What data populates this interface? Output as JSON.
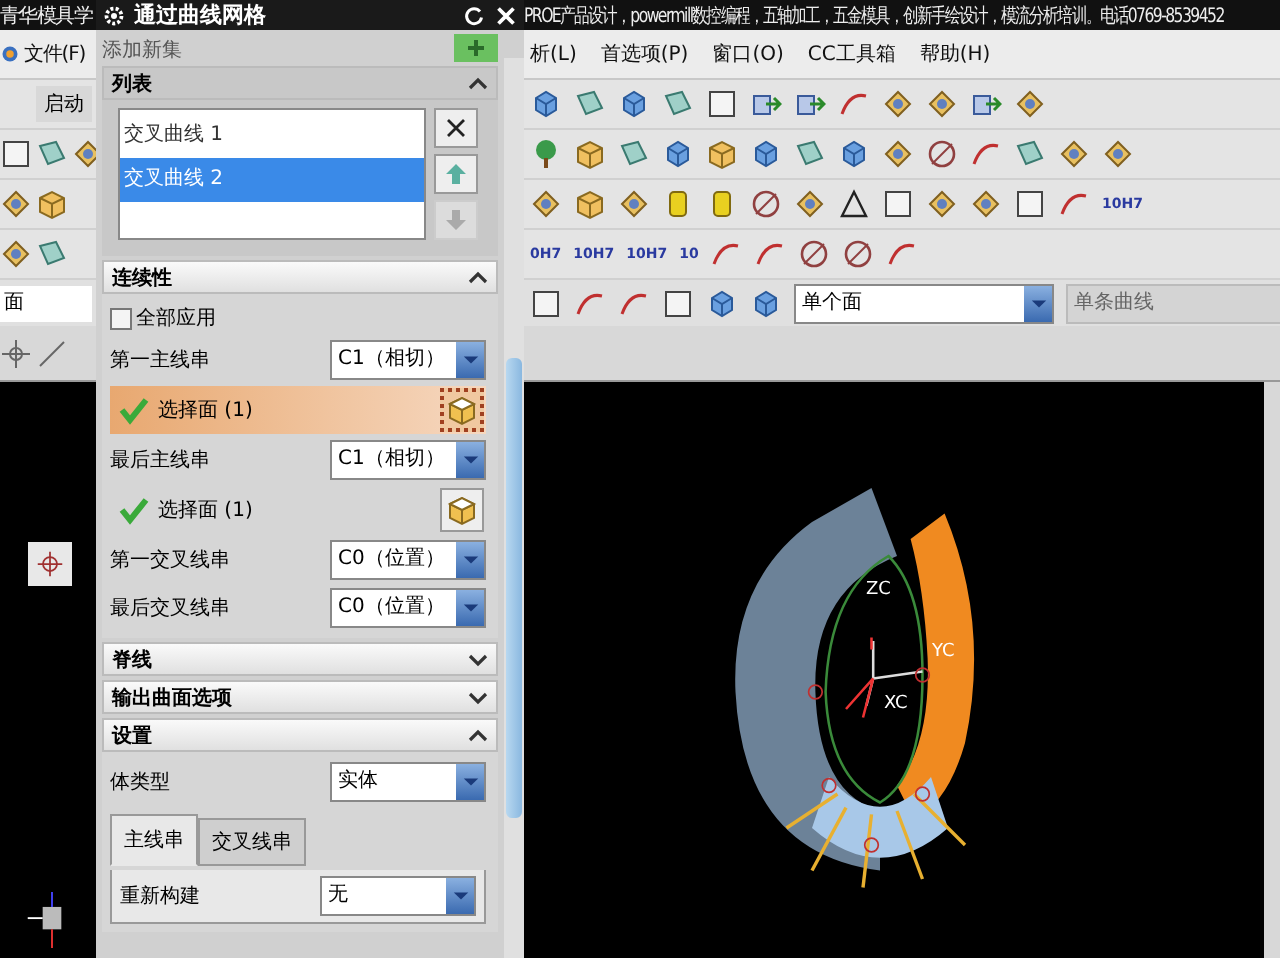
{
  "title_bar": {
    "left": "青华模具学",
    "right": "PROE产品设计，powermill数控编程，五轴加工，五金模具，创新手绘设计，模流分析培训。电话0769-8539452"
  },
  "menu_left": [
    "文件(F)"
  ],
  "menu_right": [
    "析(L)",
    "首选项(P)",
    "窗口(O)",
    "CC工具箱",
    "帮助(H)"
  ],
  "start_button": "启动",
  "toolbar_row3_label": "10H7",
  "toolbar_row4_labels": [
    "0H7",
    "10H7",
    "10H7",
    "10"
  ],
  "left_filter": "面",
  "selection_bar": {
    "face_filter": "单个面",
    "curve_filter": "单条曲线",
    "curve_filter_disabled": true
  },
  "dialog": {
    "title": "通过曲线网格",
    "add_set": "添加新集",
    "sections": [
      {
        "kind": "list",
        "title": "列表",
        "expanded": true,
        "items": [
          {
            "label": "交叉曲线 1",
            "selected": false
          },
          {
            "label": "交叉曲线 2",
            "selected": true
          }
        ],
        "move_down_disabled": true
      },
      {
        "kind": "continuity",
        "title": "连续性",
        "expanded": true,
        "apply_all": {
          "label": "全部应用",
          "checked": false
        },
        "rows": [
          {
            "kind": "dropdown",
            "label": "第一主线串",
            "value": "C1（相切）"
          },
          {
            "kind": "selection",
            "label": "选择面 (1)",
            "active": true
          },
          {
            "kind": "dropdown",
            "label": "最后主线串",
            "value": "C1（相切）"
          },
          {
            "kind": "selection",
            "label": "选择面 (1)",
            "active": false
          },
          {
            "kind": "dropdown",
            "label": "第一交叉线串",
            "value": "C0（位置）"
          },
          {
            "kind": "dropdown",
            "label": "最后交叉线串",
            "value": "C0（位置）"
          }
        ]
      },
      {
        "kind": "header",
        "title": "脊线",
        "expanded": false
      },
      {
        "kind": "header",
        "title": "输出曲面选项",
        "expanded": false
      },
      {
        "kind": "settings",
        "title": "设置",
        "expanded": true,
        "body_type": {
          "label": "体类型",
          "value": "实体"
        },
        "tabs": [
          {
            "label": "主线串",
            "selected": true
          },
          {
            "label": "交叉线串",
            "selected": false
          }
        ],
        "rebuild": {
          "label": "重新构建",
          "value": "无"
        }
      }
    ]
  },
  "viewport": {
    "axis_labels": [
      "ZC",
      "YC",
      "XC"
    ]
  }
}
